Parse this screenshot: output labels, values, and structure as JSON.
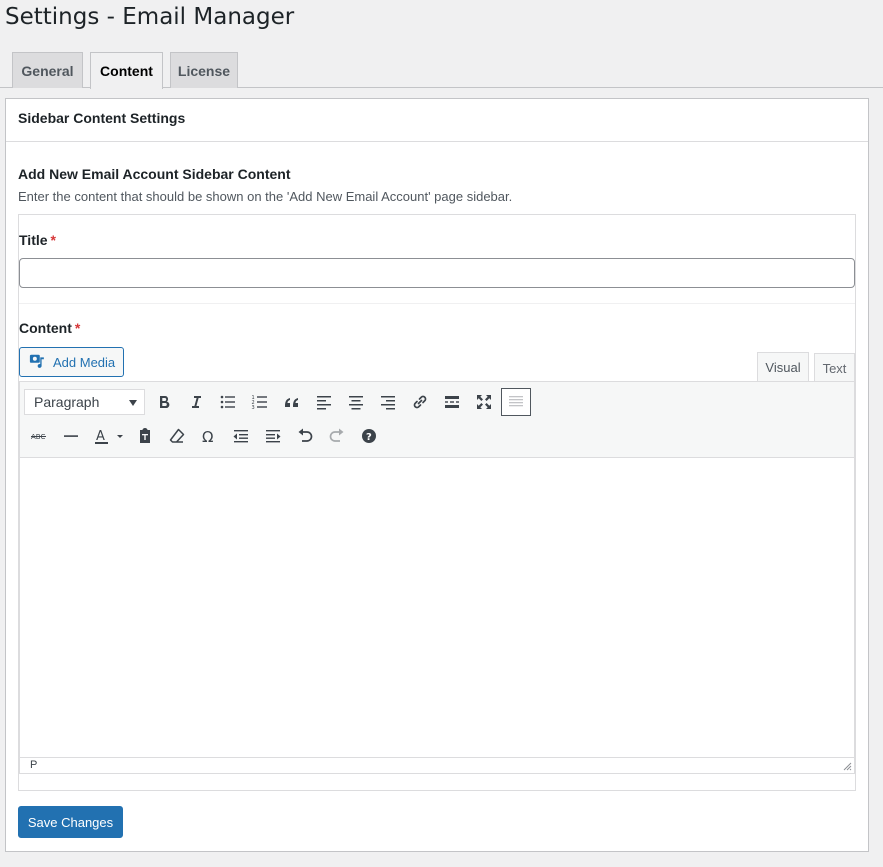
{
  "page": {
    "title": "Settings - Email Manager"
  },
  "tabs": [
    {
      "label": "General",
      "active": false
    },
    {
      "label": "Content",
      "active": true
    },
    {
      "label": "License",
      "active": false
    }
  ],
  "panel": {
    "heading": "Sidebar Content Settings",
    "section_title": "Add New Email Account Sidebar Content",
    "section_description": "Enter the content that should be shown on the 'Add New Email Account' page sidebar."
  },
  "form": {
    "title_label": "Title",
    "required_mark": "*",
    "title_value": "",
    "content_label": "Content",
    "add_media_label": "Add Media"
  },
  "editor": {
    "modes": [
      {
        "label": "Visual",
        "active": true
      },
      {
        "label": "Text",
        "active": false
      }
    ],
    "format_selected": "Paragraph",
    "status_path": "P",
    "row1_icons": [
      "bold-icon",
      "italic-icon",
      "bulleted-list-icon",
      "numbered-list-icon",
      "blockquote-icon",
      "align-left-icon",
      "align-center-icon",
      "align-right-icon",
      "link-icon",
      "read-more-icon",
      "fullscreen-icon",
      "toolbar-toggle-icon"
    ],
    "row2_icons": [
      "strikethrough-icon",
      "horizontal-line-icon",
      "text-color-icon",
      "paste-as-text-icon",
      "clear-formatting-icon",
      "special-character-icon",
      "outdent-icon",
      "indent-icon",
      "undo-icon",
      "redo-icon",
      "help-icon"
    ]
  },
  "actions": {
    "save_label": "Save Changes"
  },
  "colors": {
    "primary": "#2271b1",
    "required": "#d63638",
    "background": "#f0f0f1"
  }
}
